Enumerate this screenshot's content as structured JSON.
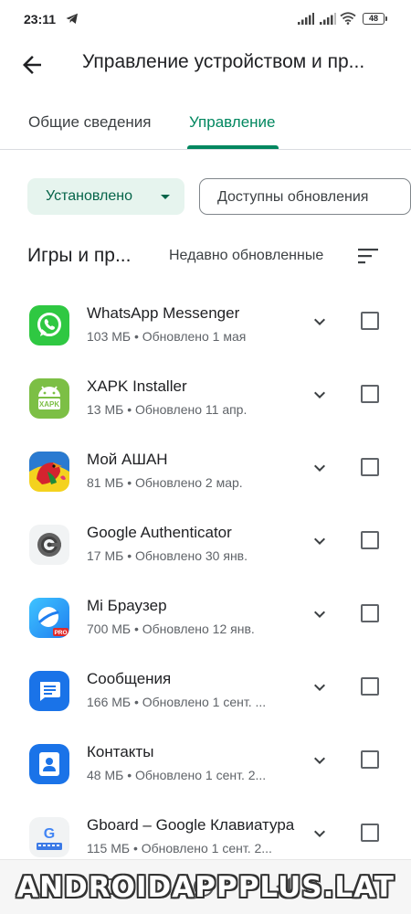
{
  "status_bar": {
    "time": "23:11",
    "battery": "48"
  },
  "header": {
    "back_icon": "arrow-back-icon",
    "title": "Управление устройством и пр..."
  },
  "tabs": [
    {
      "label": "Общие сведения",
      "active": false
    },
    {
      "label": "Управление",
      "active": true
    }
  ],
  "filters": {
    "installed": "Установлено",
    "updates": "Доступны обновления"
  },
  "section": {
    "title": "Игры и пр...",
    "sort": "Недавно обновленные"
  },
  "apps": [
    {
      "name": "WhatsApp Messenger",
      "meta": "103 МБ  •  Обновлено 1 мая",
      "icon": "whatsapp-icon"
    },
    {
      "name": "XAPK Installer",
      "meta": "13 МБ  •  Обновлено 11 апр.",
      "icon": "xapk-installer-icon",
      "icon_label": "XAPK"
    },
    {
      "name": "Мой АШАН",
      "meta": "81 МБ  •  Обновлено 2 мар.",
      "icon": "auchan-bird-icon"
    },
    {
      "name": "Google Authenticator",
      "meta": "17 МБ  •  Обновлено 30 янв.",
      "icon": "google-authenticator-icon"
    },
    {
      "name": "Mi Браузер",
      "meta": "700 МБ  •  Обновлено 12 янв.",
      "icon": "mi-browser-icon",
      "icon_label": "PRO"
    },
    {
      "name": "Сообщения",
      "meta": "166 МБ  •  Обновлено 1 сент. ...",
      "icon": "messages-icon"
    },
    {
      "name": "Контакты",
      "meta": "48 МБ  •  Обновлено 1 сент. 2...",
      "icon": "contacts-icon"
    },
    {
      "name": "Gboard – Google Клавиатура",
      "meta": "115 МБ  •  Обновлено 1 сент. 2...",
      "icon": "gboard-icon"
    }
  ],
  "watermark": "ANDROIDAPPPLUS.LAT",
  "colors": {
    "accent": "#01875f",
    "chip_bg": "#e6f4ee",
    "text": "#202124",
    "secondary": "#5f6368"
  }
}
